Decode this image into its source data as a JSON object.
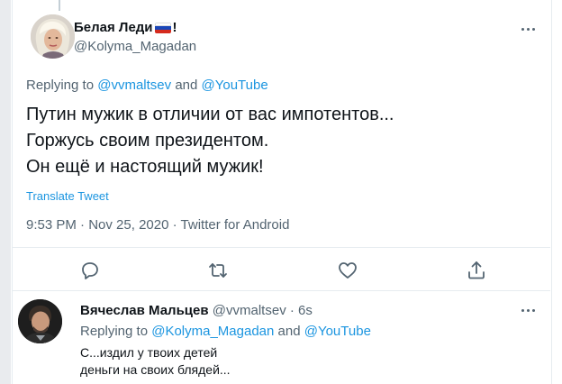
{
  "tweet": {
    "author_name": "Белая Леди",
    "author_name_suffix": "!",
    "author_handle": "@Kolyma_Magadan",
    "flag_colors": [
      "#ffffff",
      "#1a47b8",
      "#d52b1e"
    ],
    "replying_prefix": "Replying to",
    "replying_to_1": "@vvmaltsev",
    "replying_and": "and",
    "replying_to_2": "@YouTube",
    "text_lines": [
      "Путин мужик в отличии от вас импотентов...",
      "Горжусь своим президентом.",
      "Он ещё и настоящий мужик!"
    ],
    "translate_label": "Translate Tweet",
    "time": "9:53 PM",
    "separator": "·",
    "date": "Nov 25, 2020",
    "source": "Twitter for Android",
    "actions": [
      "reply-icon",
      "retweet-icon",
      "like-icon",
      "share-icon"
    ]
  },
  "reply": {
    "author_name": "Вячеслав Мальцев",
    "author_handle": "@vvmaltsev",
    "separator": "·",
    "time": "6s",
    "replying_prefix": "Replying to",
    "replying_to_1": "@Kolyma_Magadan",
    "replying_and": "and",
    "replying_to_2": "@YouTube",
    "text_lines": [
      "С...издил у твоих детей",
      "деньги на своих блядей..."
    ]
  },
  "colors": {
    "link": "#1b95e0",
    "secondary_text": "#536471",
    "primary_text": "#0f1419",
    "divider": "#e6ecf0"
  }
}
